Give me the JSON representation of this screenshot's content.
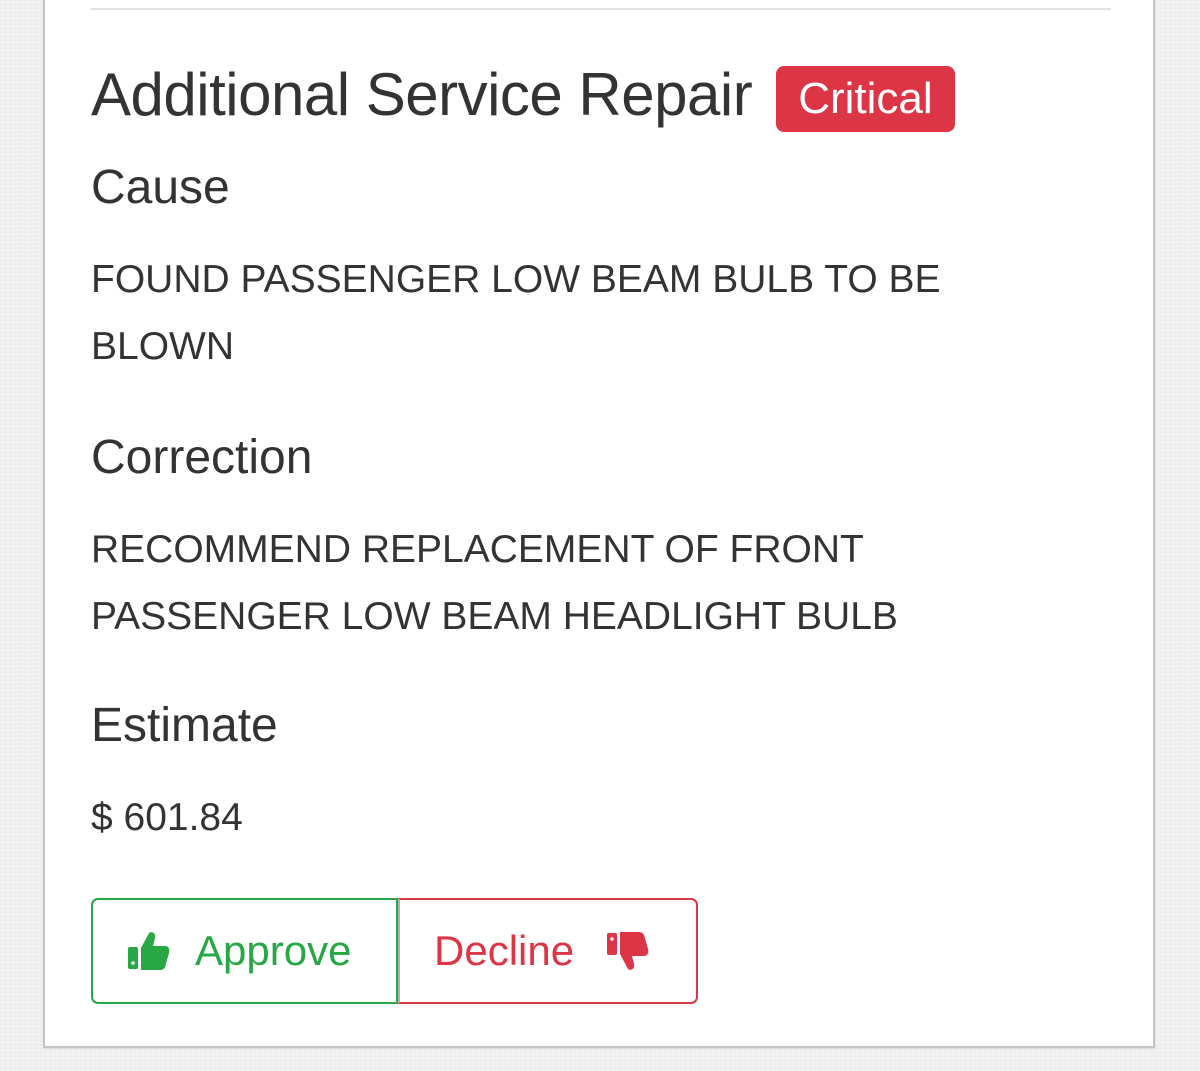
{
  "service": {
    "title": "Additional Service Repair",
    "severity_badge": "Critical",
    "cause": {
      "heading": "Cause",
      "text": "FOUND PASSENGER LOW BEAM BULB TO BE BLOWN"
    },
    "correction": {
      "heading": "Correction",
      "text": "RECOMMEND REPLACEMENT OF FRONT PASSENGER LOW BEAM HEADLIGHT BULB"
    },
    "estimate": {
      "heading": "Estimate",
      "amount": "$ 601.84"
    }
  },
  "actions": {
    "approve_label": "Approve",
    "approve_icon": "thumbs-up-icon",
    "decline_label": "Decline",
    "decline_icon": "thumbs-down-icon"
  },
  "colors": {
    "critical": "#dc3545",
    "approve": "#28a745",
    "decline": "#dc3545",
    "text": "#333333"
  }
}
